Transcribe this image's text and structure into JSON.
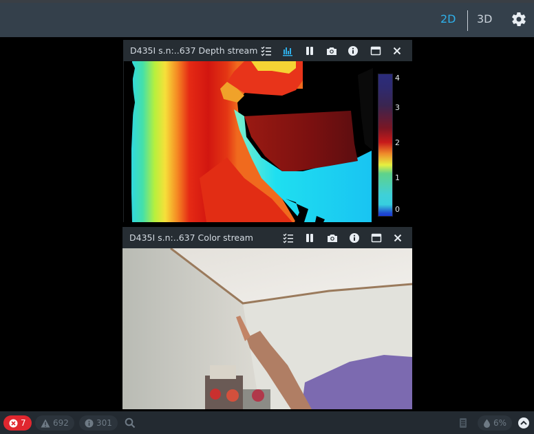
{
  "topbar": {
    "view_2d_label": "2D",
    "view_3d_label": "3D",
    "settings_icon": "gear-icon"
  },
  "depth_panel": {
    "title": "D435I s.n:..637 Depth stream",
    "toolbar_icons": [
      "checklist-icon",
      "histogram-icon",
      "pause-icon",
      "camera-icon",
      "info-icon",
      "maximize-icon",
      "close-icon"
    ],
    "colorbar_labels": [
      "4",
      "3",
      "2",
      "1",
      "0"
    ]
  },
  "color_panel": {
    "title": "D435I s.n:..637 Color stream",
    "toolbar_icons": [
      "checklist-icon",
      "pause-icon",
      "camera-icon",
      "info-icon",
      "maximize-icon",
      "close-icon"
    ]
  },
  "statusbar": {
    "errors": "7",
    "warnings": "692",
    "info": "301",
    "cpu": "6%"
  },
  "colors": {
    "accent": "#2fb0ea",
    "error": "#e0272f",
    "topbar_bg": "#34404b"
  }
}
